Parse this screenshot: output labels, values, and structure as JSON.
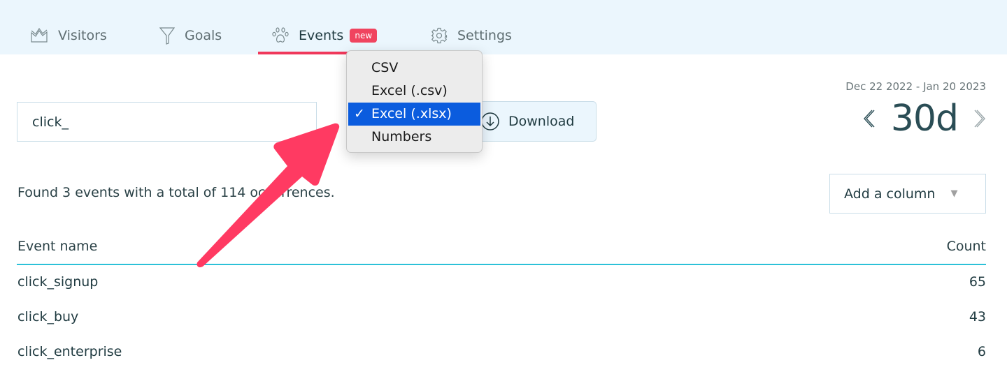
{
  "nav": {
    "tabs": [
      {
        "label": "Visitors",
        "icon": "chart-area-icon"
      },
      {
        "label": "Goals",
        "icon": "funnel-icon"
      },
      {
        "label": "Events",
        "icon": "paw-icon",
        "badge": "new",
        "active": true
      },
      {
        "label": "Settings",
        "icon": "gear-icon"
      }
    ],
    "accent": "#f0385b"
  },
  "search": {
    "value": "click_"
  },
  "download": {
    "label": "Download",
    "icon": "download-icon"
  },
  "format_menu": {
    "options": [
      "CSV",
      "Excel (.csv)",
      "Excel (.xlsx)",
      "Numbers"
    ],
    "selected": "Excel (.xlsx)",
    "check": "✓"
  },
  "date": {
    "range": "Dec 22 2022 - Jan 20 2023",
    "period": "30d"
  },
  "summary": {
    "text": "Found 3 events with a total of 114 occurrences."
  },
  "add_column": {
    "label": "Add a column"
  },
  "table": {
    "headers": {
      "name": "Event name",
      "count": "Count"
    },
    "rows": [
      {
        "name": "click_signup",
        "count": "65"
      },
      {
        "name": "click_buy",
        "count": "43"
      },
      {
        "name": "click_enterprise",
        "count": "6"
      }
    ]
  },
  "annotation": {
    "type": "arrow",
    "color": "#ff3a62"
  }
}
